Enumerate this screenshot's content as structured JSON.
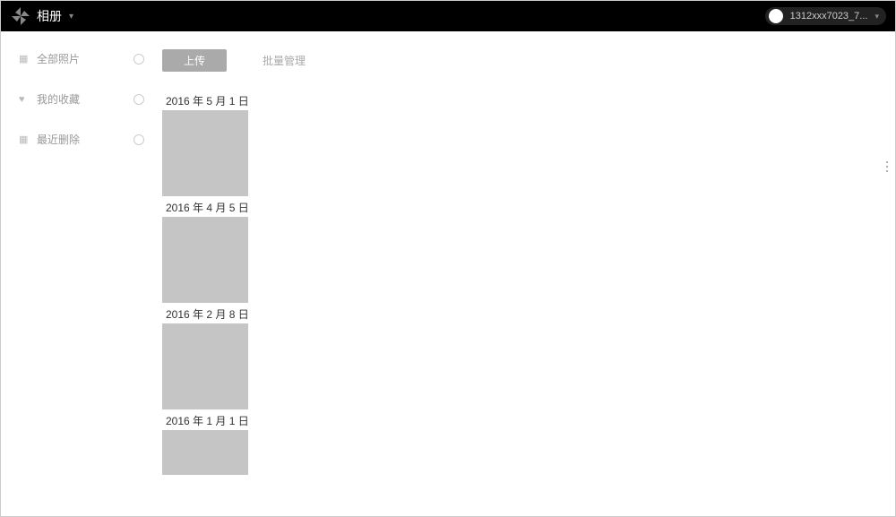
{
  "header": {
    "app_title": "相册",
    "username": "1312xxx7023_7..."
  },
  "sidebar": {
    "items": [
      {
        "label": "全部照片",
        "icon": "▦"
      },
      {
        "label": "我的收藏",
        "icon": "♥"
      },
      {
        "label": "最近删除",
        "icon": "▦"
      }
    ]
  },
  "toolbar": {
    "upload_label": "上传",
    "batch_label": "批量管理"
  },
  "photo_groups": [
    {
      "date": "2016 年 5 月 1 日"
    },
    {
      "date": "2016 年 4 月 5 日"
    },
    {
      "date": "2016 年 2 月 8 日"
    },
    {
      "date": "2016 年 1 月 1 日"
    }
  ]
}
